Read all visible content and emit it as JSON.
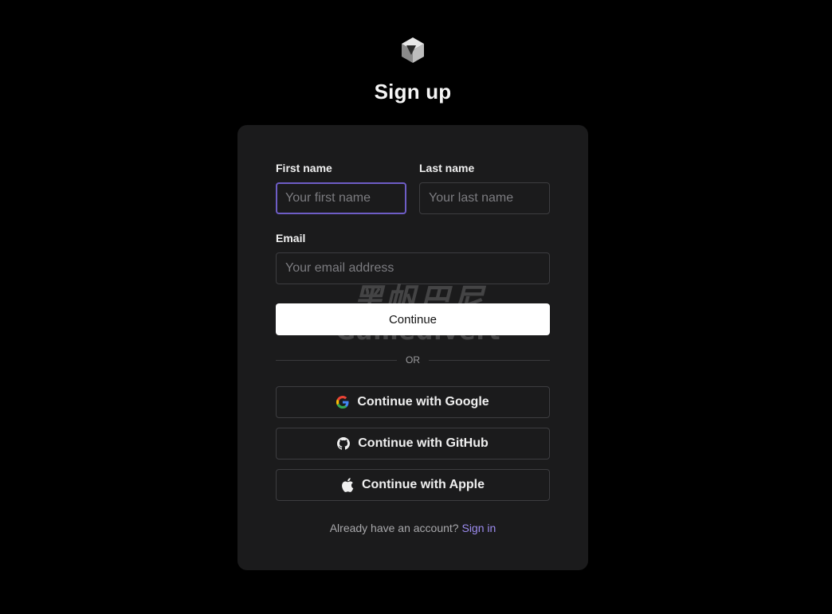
{
  "header": {
    "title": "Sign up",
    "logo_icon": "cube-logo-icon"
  },
  "form": {
    "first_name_label": "First name",
    "first_name_placeholder": "Your first name",
    "first_name_value": "",
    "last_name_label": "Last name",
    "last_name_placeholder": "Your last name",
    "last_name_value": "",
    "email_label": "Email",
    "email_placeholder": "Your email address",
    "email_value": "",
    "continue_label": "Continue",
    "divider_text": "OR"
  },
  "oauth": [
    {
      "label": "Continue with Google",
      "icon": "google-icon"
    },
    {
      "label": "Continue with GitHub",
      "icon": "github-icon"
    },
    {
      "label": "Continue with Apple",
      "icon": "apple-icon"
    }
  ],
  "footer": {
    "prompt": "Already have an account?",
    "link": "Sign in"
  },
  "watermark": {
    "line1": "黑帆巴尼",
    "line2": "Gamedivert"
  },
  "colors": {
    "background": "#000000",
    "card": "#1b1b1c",
    "accent": "#6e5dc6",
    "link": "#9d8cf0"
  }
}
